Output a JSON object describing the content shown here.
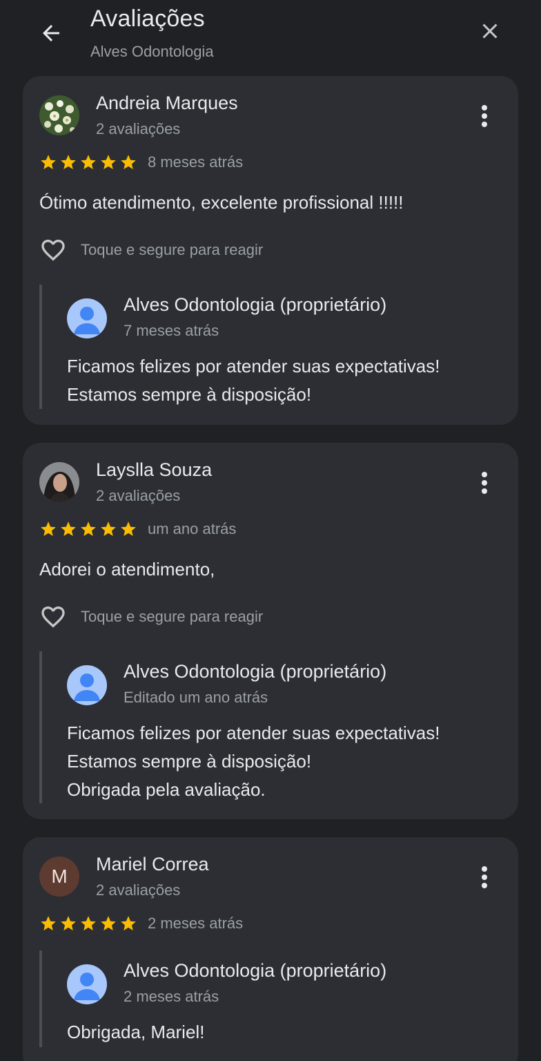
{
  "header": {
    "title": "Avaliações",
    "subtitle": "Alves Odontologia",
    "back_icon": "arrow-left-icon",
    "close_icon": "close-icon"
  },
  "colors": {
    "background": "#202124",
    "card": "#2c2e33",
    "star": "#fbbc04",
    "muted_text": "#9aa0a6",
    "owner_avatar": "#a8c7fa",
    "owner_avatar_figure": "#4285f4"
  },
  "reviews": [
    {
      "author": "Andreia Marques",
      "author_meta": "2 avaliações",
      "rating": 5,
      "date": "8 meses atrás",
      "text": "Ótimo atendimento, excelente profissional !!!!!",
      "react_label": "Toque e segure para reagir",
      "reply": {
        "owner": "Alves Odontologia (proprietário)",
        "date": "7 meses atrás",
        "lines": [
          "Ficamos felizes por atender suas expectativas!",
          "Estamos sempre à disposição!"
        ]
      }
    },
    {
      "author": "Layslla Souza",
      "author_meta": "2 avaliações",
      "rating": 5,
      "date": "um ano atrás",
      "text": "Adorei o atendimento,",
      "react_label": "Toque e segure para reagir",
      "reply": {
        "owner": "Alves Odontologia (proprietário)",
        "date": "Editado um ano atrás",
        "lines": [
          "Ficamos felizes por atender suas expectativas!",
          "Estamos sempre à disposição!",
          "Obrigada pela avaliação."
        ]
      }
    },
    {
      "author": "Mariel Correa",
      "author_initial": "M",
      "author_meta": "2 avaliações",
      "rating": 5,
      "date": "2 meses atrás",
      "reply": {
        "owner": "Alves Odontologia (proprietário)",
        "date": "2 meses atrás",
        "lines": [
          "Obrigada, Mariel!"
        ]
      }
    }
  ]
}
